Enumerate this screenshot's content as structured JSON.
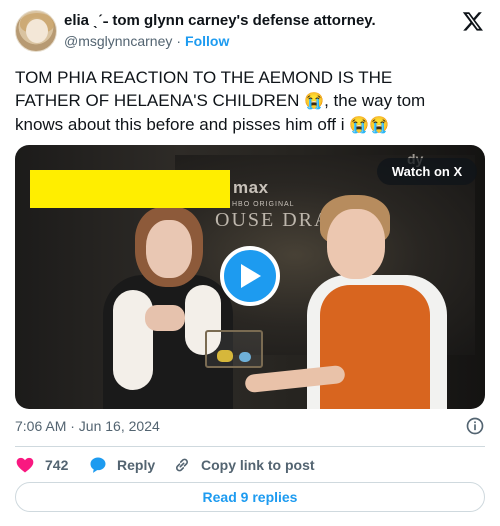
{
  "author": {
    "display_name": "elia ˎˊ˗ tom glynn carney's defense attorney.",
    "handle": "@msglynncarney",
    "separator": "·",
    "follow_label": "Follow"
  },
  "tweet": {
    "text_line1": "TOM PHIA REACTION TO THE AEMOND IS THE",
    "text_line2": "FATHER OF HELAENA'S CHILDREN",
    "text_line2b": ", the way tom",
    "text_line3": "knows about this before and pisses him off i",
    "emoji": "😭"
  },
  "media": {
    "watch_label": "Watch on X",
    "brand_max": "max",
    "brand_original": "HBO ORIGINAL",
    "brand_show": "OUSE DRAG",
    "watermark": "dy"
  },
  "meta": {
    "timestamp": "7:06 AM · Jun 16, 2024"
  },
  "actions": {
    "like_count": "742",
    "reply_label": "Reply",
    "copy_label": "Copy link to post",
    "read_replies_label": "Read 9 replies"
  },
  "colors": {
    "accent": "#1d9bf0",
    "like": "#f91880",
    "redaction": "#ffee00",
    "vest": "#d8651f"
  },
  "icons": [
    "x-logo-icon",
    "play-icon",
    "info-icon",
    "heart-icon",
    "reply-bubble-icon",
    "link-icon"
  ]
}
